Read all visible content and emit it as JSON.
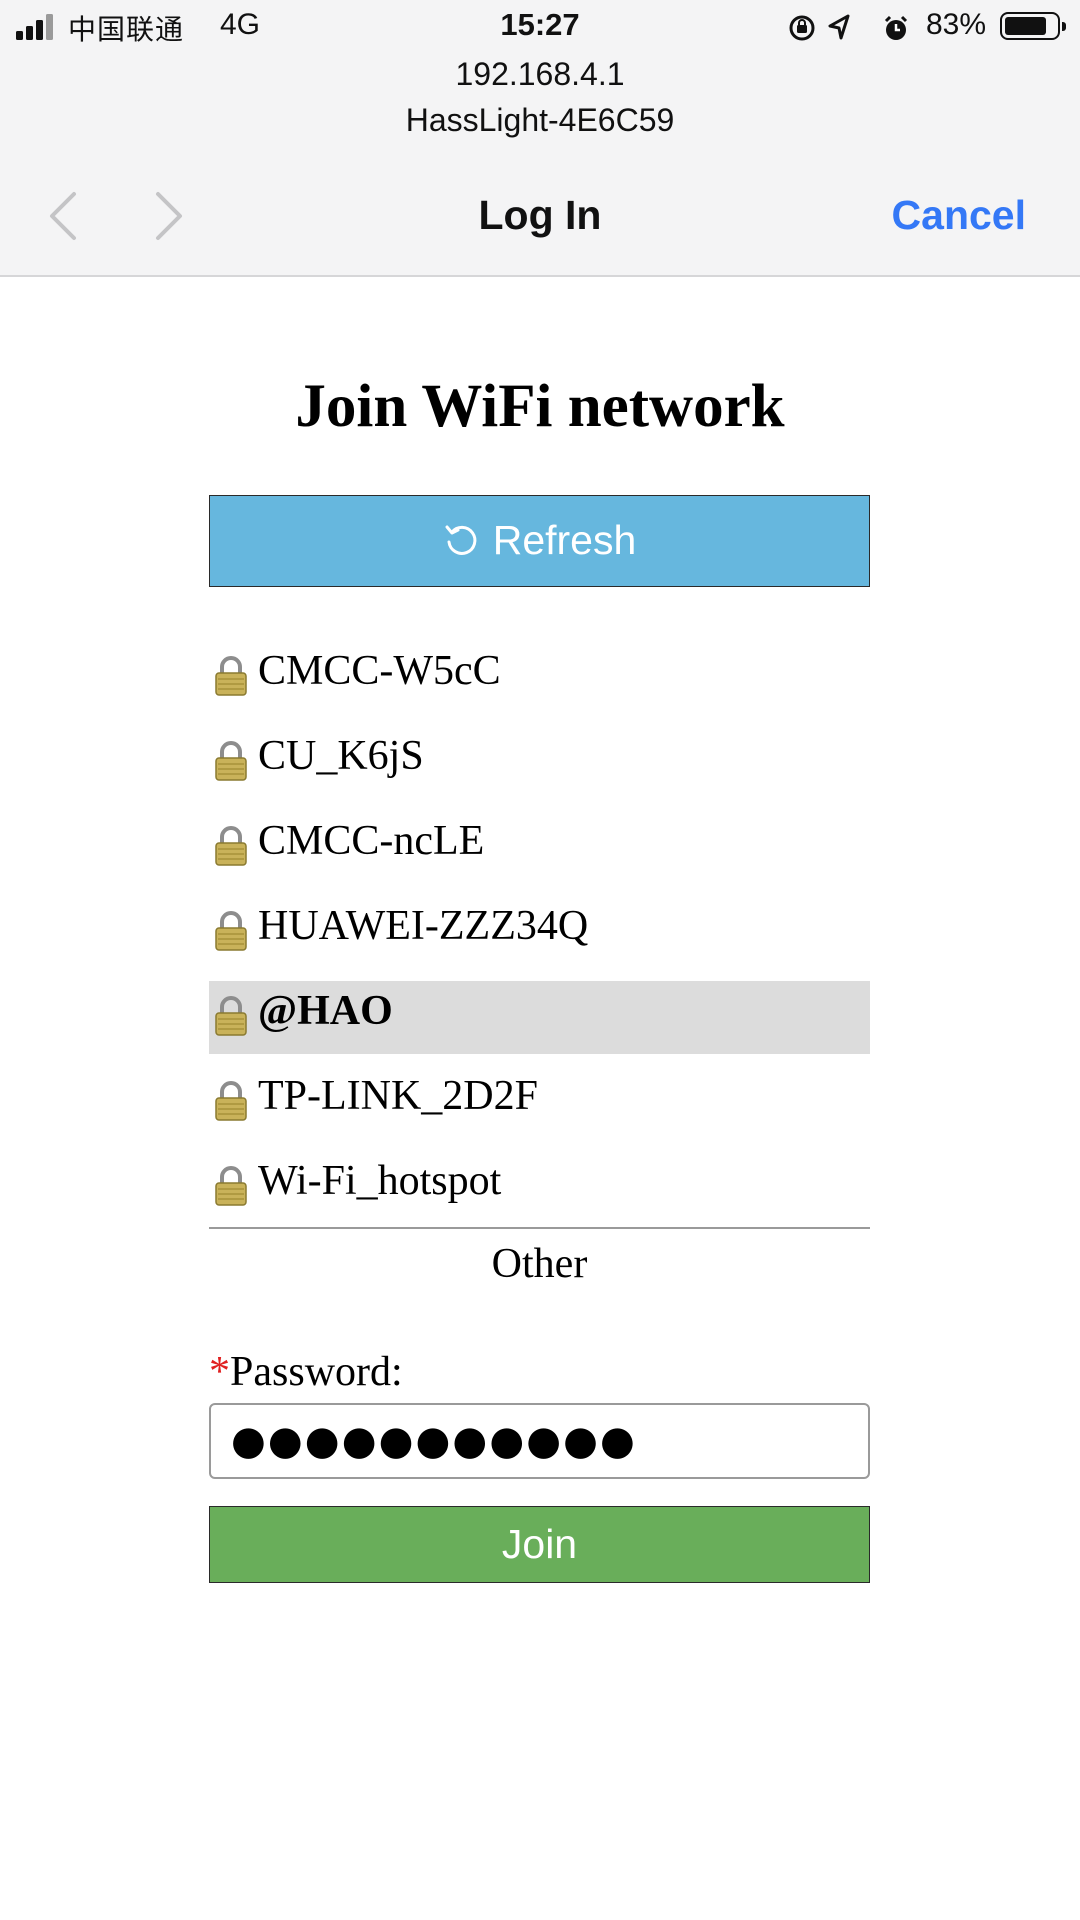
{
  "status_bar": {
    "carrier": "中国联通",
    "network": "4G",
    "time": "15:27",
    "battery_percent": "83%",
    "battery_level": 0.83,
    "icons": [
      "signal-icon",
      "rotation-lock-icon",
      "location-icon",
      "alarm-icon",
      "battery-icon"
    ]
  },
  "browser": {
    "url": "192.168.4.1",
    "subtitle": "HassLight-4E6C59",
    "title": "Log In",
    "cancel_label": "Cancel",
    "accent_color": "#3478f6"
  },
  "page": {
    "heading": "Join WiFi network",
    "refresh_label": "Refresh",
    "refresh_color": "#66b7de",
    "networks": [
      {
        "name": "CMCC-W5cC",
        "selected": false
      },
      {
        "name": "CU_K6jS",
        "selected": false
      },
      {
        "name": "CMCC-ncLE",
        "selected": false
      },
      {
        "name": "HUAWEI-ZZZ34Q",
        "selected": false
      },
      {
        "name": "@HAO",
        "selected": true
      },
      {
        "name": "TP-LINK_2D2F",
        "selected": false
      },
      {
        "name": "Wi-Fi_hotspot",
        "selected": false
      }
    ],
    "other_label": "Other",
    "password_required_mark": "*",
    "password_label": "Password:",
    "password_value": "●●●●●●●●●●●",
    "join_label": "Join",
    "join_color": "#69ae5a"
  }
}
